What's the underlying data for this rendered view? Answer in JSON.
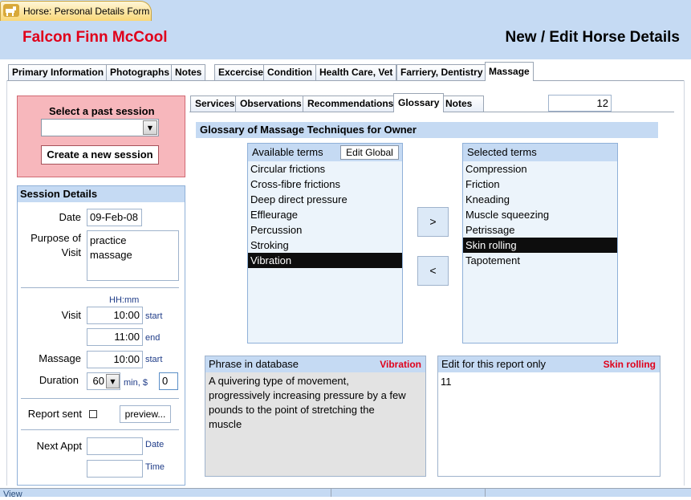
{
  "window": {
    "tab_title": "Horse: Personal Details Form",
    "icon": "horse-icon"
  },
  "header": {
    "horse_name": "Falcon Finn McCool",
    "title": "New / Edit Horse Details"
  },
  "main_tabs": [
    "Primary Information",
    "Photographs",
    "Notes",
    "Excercise",
    "Condition",
    "Health Care, Vet",
    "Farriery, Dentistry",
    "Massage"
  ],
  "active_main_tab": "Massage",
  "session": {
    "select_label": "Select a past session",
    "selected_value": "",
    "new_session_label": "Create a new session"
  },
  "session_details": {
    "title": "Session Details",
    "date_label": "Date",
    "date_value": "09-Feb-08",
    "purpose_label_1": "Purpose of",
    "purpose_label_2": "Visit",
    "purpose_value_1": "practice",
    "purpose_value_2": "massage",
    "time_format": "HH:mm",
    "visit_label": "Visit",
    "visit_start": "10:00",
    "visit_end": "11:00",
    "start_label": "start",
    "end_label": "end",
    "massage_label": "Massage",
    "massage_start": "10:00",
    "massage_start_label": "start",
    "duration_label": "Duration",
    "duration_value": "60",
    "duration_unit": "min, $",
    "cost_value": "0",
    "report_sent_label": "Report sent",
    "report_sent_checked": false,
    "preview_label": "preview...",
    "next_appt_label": "Next Appt",
    "next_date_label": "Date",
    "next_time_label": "Time",
    "next_date_value": "",
    "next_time_value": ""
  },
  "sub_tabs": [
    "Services",
    "Observations",
    "Recommendations",
    "Glossary",
    "Notes"
  ],
  "active_sub_tab": "Glossary",
  "session_number": "12",
  "glossary": {
    "title": "Glossary of Massage Techniques for Owner",
    "available_header": "Available terms",
    "edit_global_label": "Edit Global",
    "available": [
      "Circular frictions",
      "Cross-fibre frictions",
      "Deep direct pressure",
      "Effleurage",
      "Percussion",
      "Stroking",
      "Vibration"
    ],
    "available_selected": "Vibration",
    "selected_header": "Selected terms",
    "selected": [
      "Compression",
      "Friction",
      "Kneading",
      "Muscle squeezing",
      "Petrissage",
      "Skin rolling",
      "Tapotement"
    ],
    "selected_selected": "Skin rolling",
    "add_label": ">",
    "remove_label": "<"
  },
  "phrase": {
    "header": "Phrase in database",
    "term": "Vibration",
    "lines": [
      "A quivering type of movement,",
      "progressively increasing pressure by a few",
      "pounds to the point of stretching the",
      "muscle"
    ]
  },
  "edit": {
    "header": "Edit for this report only",
    "term": "Skin rolling",
    "value": "11"
  },
  "status": {
    "text": "View"
  },
  "colors": {
    "header_bg": "#c5daf3",
    "name_red": "#e0001b",
    "session_panel": "#f7b7bc",
    "list_bg": "#ecf4fb"
  }
}
